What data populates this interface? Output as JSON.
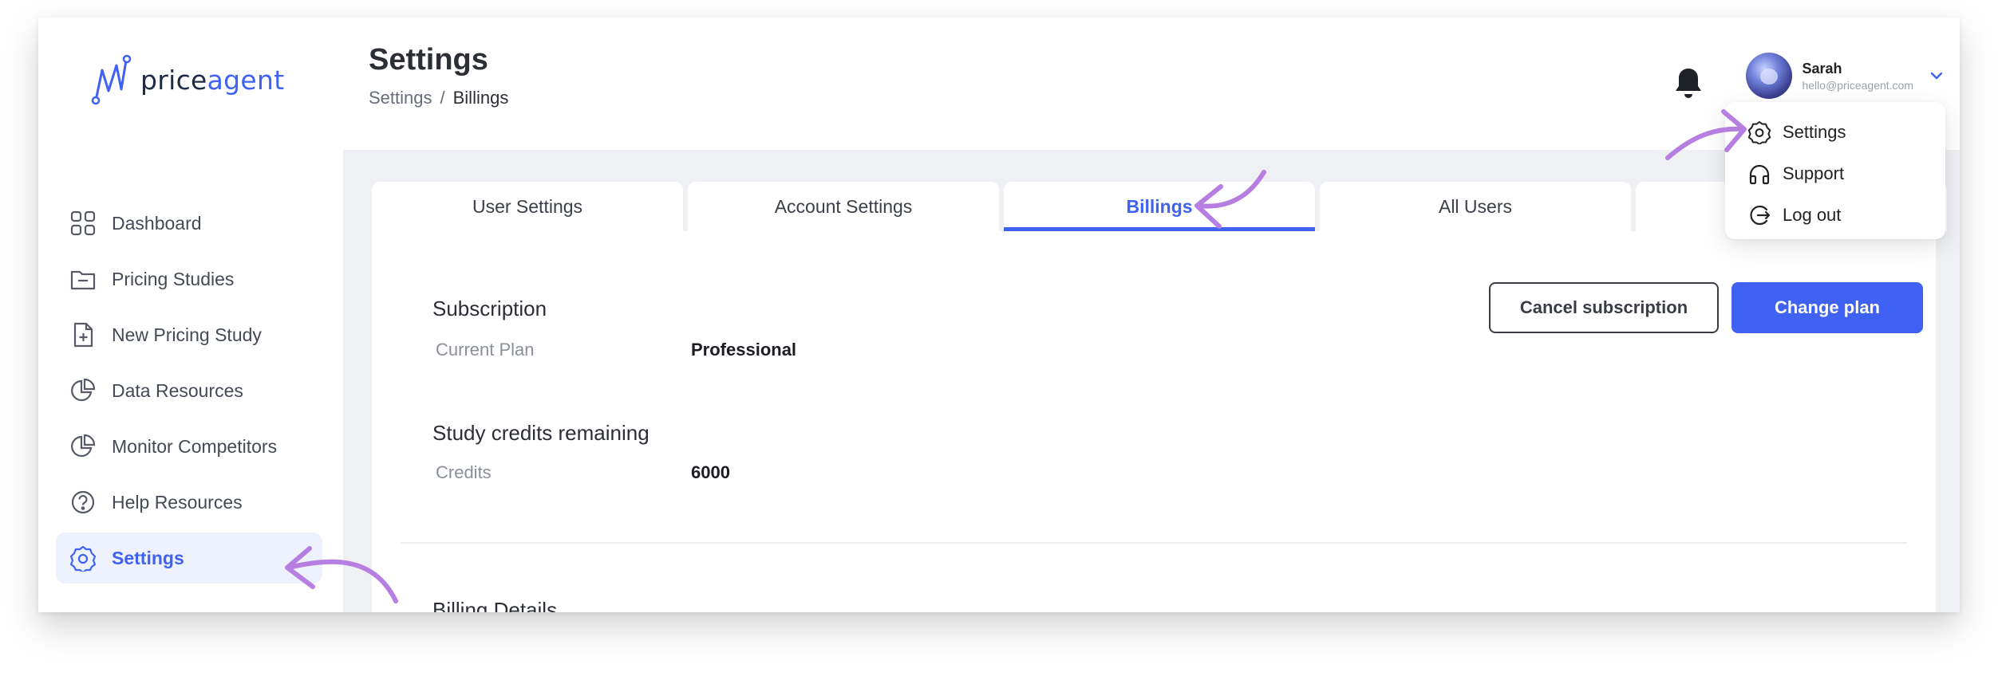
{
  "brand": {
    "name_prefix": "price",
    "name_accent": "agent",
    "accent_color": "#3f62f2"
  },
  "sidebar": {
    "items": [
      {
        "label": "Dashboard",
        "icon": "grid-icon",
        "active": false
      },
      {
        "label": "Pricing Studies",
        "icon": "folder-icon",
        "active": false
      },
      {
        "label": "New Pricing Study",
        "icon": "file-plus-icon",
        "active": false
      },
      {
        "label": "Data Resources",
        "icon": "pie-chart-icon",
        "active": false
      },
      {
        "label": "Monitor Competitors",
        "icon": "pie-chart-icon",
        "active": false
      },
      {
        "label": "Help Resources",
        "icon": "help-circle-icon",
        "active": false
      },
      {
        "label": "Settings",
        "icon": "gear-icon",
        "active": true
      }
    ]
  },
  "header": {
    "title": "Settings",
    "breadcrumb": {
      "root": "Settings",
      "separator": "/",
      "current": "Billings"
    },
    "user": {
      "name": "Sarah",
      "email": "hello@priceagent.com"
    }
  },
  "tabs": [
    {
      "label": "User Settings",
      "active": false
    },
    {
      "label": "Account Settings",
      "active": false
    },
    {
      "label": "Billings",
      "active": true
    },
    {
      "label": "All Users",
      "active": false
    },
    {
      "label": "",
      "active": false
    }
  ],
  "billing": {
    "subscription_title": "Subscription",
    "current_plan_label": "Current Plan",
    "current_plan_value": "Professional",
    "credits_title": "Study credits remaining",
    "credits_label": "Credits",
    "credits_value": "6000",
    "billing_details_title": "Billing Details",
    "cancel_button": "Cancel subscription",
    "change_plan_button": "Change plan"
  },
  "user_menu": {
    "items": [
      {
        "label": "Settings",
        "icon": "gear-icon"
      },
      {
        "label": "Support",
        "icon": "headphones-icon"
      },
      {
        "label": "Log out",
        "icon": "logout-icon"
      }
    ]
  },
  "annotation_color": "#b57ee0"
}
